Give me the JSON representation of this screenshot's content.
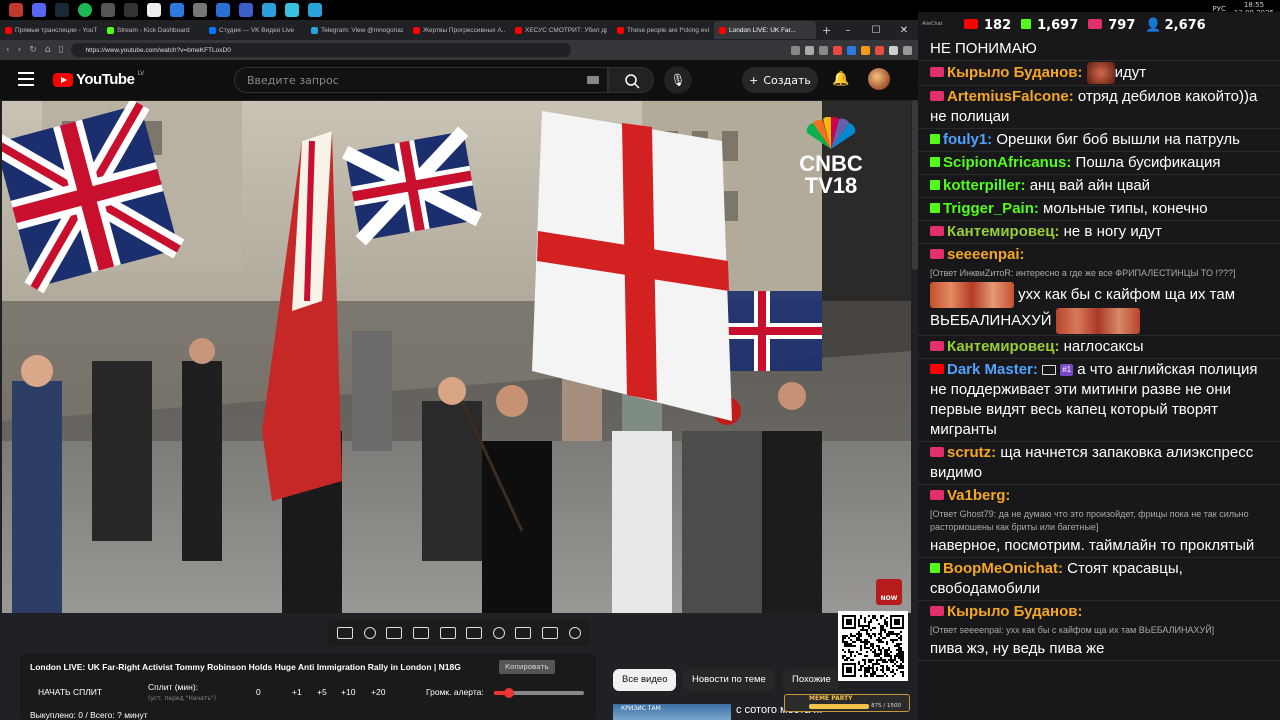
{
  "taskbar": {
    "lang": "РУС",
    "time": "18:55",
    "date": "13.09.2025"
  },
  "browser": {
    "tabs": [
      {
        "label": "Прямые трансляции - YouTube",
        "color": "#ff0000"
      },
      {
        "label": "Stream - Kick Dashboard",
        "color": "#53fc18"
      },
      {
        "label": "Студия — VK Видео Live",
        "color": "#0077ff"
      },
      {
        "label": "Telegram: View @mnogonazi",
        "color": "#2aa1da"
      },
      {
        "label": "Жертвы Прогрессивных А...",
        "color": "#ff0000"
      },
      {
        "label": "ХЕСУС СМОТРИТ: Убил дру...",
        "color": "#ff0000"
      },
      {
        "label": "These people are f*cking evil",
        "color": "#ff0000"
      },
      {
        "label": "London LIVE: UK Far...",
        "color": "#ff0000"
      }
    ],
    "url": "https://www.youtube.com/watch?v=bmeKFTLoxD0"
  },
  "yt": {
    "logo": "YouTube",
    "country": "LV",
    "search_placeholder": "Введите запрос",
    "create": "Создать"
  },
  "video": {
    "channel_logo": "CNBC TV18",
    "cnbc_line1": "CNBC",
    "cnbc_line2": "TV18",
    "live_badge": "NOW"
  },
  "info": {
    "title": "London LIVE: UK Far-Right Activist Tommy Robinson Holds Huge Anti Immigration Rally in London | N18G",
    "copy": "Копировать",
    "split_start": "НАЧАТЬ СПЛИТ",
    "split_min": "Сплит (мин):",
    "split_hint": "(уст. перед \"Начать\")",
    "split_values": [
      "0",
      "+1",
      "+5",
      "+10",
      "+20"
    ],
    "alert_volume_label": "Громк. алерта:",
    "alert_volume": 0.17,
    "bought": "Выкуплено: 0 / Всего: ? минут"
  },
  "chips": [
    {
      "label": "Все видео",
      "selected": true
    },
    {
      "label": "Новости по теме",
      "selected": false
    },
    {
      "label": "Похожие",
      "selected": false
    }
  ],
  "rec": {
    "thumb_text": "КРИЗИС ТАМ",
    "title": "с сотого места ..."
  },
  "qr": {
    "party_label": "MEME PARTY",
    "party_count": "875 / 1500"
  },
  "chat": {
    "app_label": "AlwChat",
    "stats": {
      "youtube": "182",
      "kick": "1,697",
      "vk": "797",
      "viewers": "2,676"
    },
    "messages": [
      {
        "platform": "",
        "nick": "",
        "text": "НЕ ПОНИМАЮ",
        "color": ""
      },
      {
        "platform": "vk",
        "nick": "Кырыло Буданов:",
        "text": "идут",
        "color": "#f5a623",
        "emote": "small"
      },
      {
        "platform": "vk",
        "nick": "ArtemiusFalcone:",
        "text": "отряд дебилов какойто))а не полицаи",
        "color": "#f5a623"
      },
      {
        "platform": "kick",
        "nick": "fouly1:",
        "text": "Орешки биг боб вышли на патруль",
        "color": "#4fa3ff"
      },
      {
        "platform": "kick",
        "nick": "ScipionAfricanus:",
        "text": "Пошла бусификация",
        "color": "#53fc18"
      },
      {
        "platform": "kick",
        "nick": "kotterpiller:",
        "text": "анц вай айн цвай",
        "color": "#53fc18"
      },
      {
        "platform": "kick",
        "nick": "Trigger_Pain:",
        "text": "мольные типы, конечно",
        "color": "#53fc18"
      },
      {
        "platform": "vk",
        "nick": "Кантемировец:",
        "text": "не в ногу идут",
        "color": "#9acd32"
      },
      {
        "platform": "vk",
        "nick": "seeeenpai:",
        "reply": "[Ответ ИнквиZитоR: интересно а где же все ФРИПАЛЕСТИНЦЫ ТО !???]",
        "text": "ухх как бы с кайфом ща их там ВЬЕБАЛИНАХУЙ",
        "color": "#f5a623",
        "emote": "wide"
      },
      {
        "platform": "vk",
        "nick": "Кантемировец:",
        "text": "наглосаксы",
        "color": "#9acd32"
      },
      {
        "platform": "yt",
        "nick": "Dark Master:",
        "sub": "#1",
        "text": "а что английская полиция не поддерживает эти митинги разве не они первые видят весь капец который творят мигранты",
        "color": "#4fa3ff"
      },
      {
        "platform": "vk",
        "nick": "scrutz:",
        "text": "ща начнется запаковка алиэкспресс видимо",
        "color": "#f5a623"
      },
      {
        "platform": "vk",
        "nick": "Va1berg:",
        "reply": "[Ответ Ghost79: да не думаю что это произойдет, фрицы пока не так сильно растормошены как бриты или багетные]",
        "text": "наверное, посмотрим. таймлайн то проклятый",
        "color": "#f5a623"
      },
      {
        "platform": "kick",
        "nick": "BoopMeOnichat:",
        "text": "Стоят красавцы, свободамобили",
        "color": "#f5a623"
      },
      {
        "platform": "vk",
        "nick": "Кырыло Буданов:",
        "reply": "[Ответ seeeenpai: ухх как бы с кайфом ща их там ВЬЕБАЛИНАХУЙ]",
        "text": "пива жэ, ну ведь пива же",
        "color": "#f5a623"
      }
    ]
  }
}
